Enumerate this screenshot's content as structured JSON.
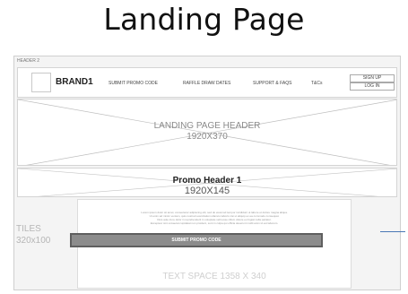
{
  "page_title": "Landing Page",
  "frame_label": "HEADER 2",
  "brand": "BRAND1",
  "nav": [
    {
      "label": "SUBMIT PROMO CODE"
    },
    {
      "label": "RAFFLE DRAW DATES"
    },
    {
      "label": "SUPPORT & FAQS"
    },
    {
      "label": "T&Cs"
    }
  ],
  "auth": {
    "signup": "SIGN UP",
    "login": "LOG IN"
  },
  "hero": {
    "title": "LANDING PAGE HEADER",
    "size": "1920X370"
  },
  "promo": {
    "title": "Promo Header 1",
    "size": "1920X145"
  },
  "tiles": {
    "label": "TILES",
    "size": "320x100"
  },
  "filler_text": [
    "Lorem ipsum dolor sit amet, consectetur adipiscing elit, sed do eiusmod tempor incididunt ut labore et dolore magna aliqua.",
    "Ut enim ad minim veniam, quis nostrud exercitation ullamco laboris nisi ut aliquip ex ea commodo consequat.",
    "Duis aute irure dolor in reprehenderit in voluptate velit esse cillum dolore eu fugiat nulla pariatur.",
    "Excepteur sint occaecat cupidatat non proident, sunt in culpa qui officia deserunt mollit anim id est laborum."
  ],
  "submit_button": "SUBMIT PROMO CODE",
  "text_space": "TEXT SPACE 1358 X 340"
}
